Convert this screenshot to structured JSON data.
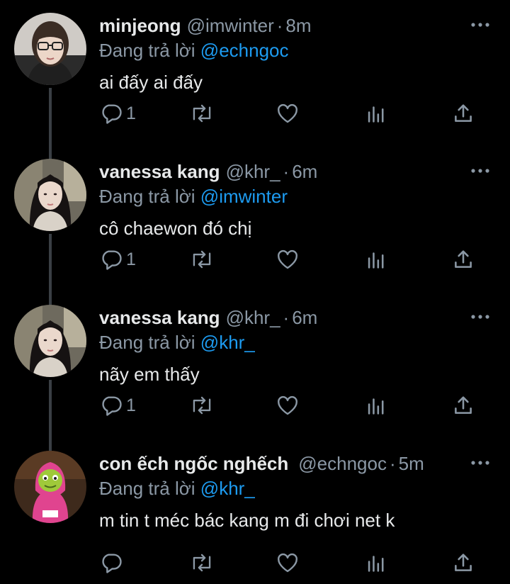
{
  "theme": {
    "background": "#000000",
    "text": "#e7e9ea",
    "muted": "#8b98a5",
    "accent": "#1d9bf0"
  },
  "tweets": [
    {
      "name": "minjeong",
      "handle": "@imwinter",
      "separator": "·",
      "time": "8m",
      "reply_prefix": "Đang trả lời",
      "reply_to": "@echngoc",
      "text": "ai đấy ai đấy",
      "reply_count": "1",
      "avatar": "avatar-photo-girl-glasses"
    },
    {
      "name": "vanessa kang",
      "handle": "@khr_",
      "separator": "·",
      "time": "6m",
      "reply_prefix": "Đang trả lời",
      "reply_to": "@imwinter",
      "text": "cô chaewon đó chị",
      "reply_count": "1",
      "avatar": "avatar-photo-girl-long-hair"
    },
    {
      "name": "vanessa kang",
      "handle": "@khr_",
      "separator": "·",
      "time": "6m",
      "reply_prefix": "Đang trả lời",
      "reply_to": "@khr_",
      "text": "nãy em thấy",
      "reply_count": "1",
      "avatar": "avatar-photo-girl-long-hair"
    },
    {
      "name": "con ếch ngốc nghếch",
      "handle": "@echngoc",
      "separator": "·",
      "time": "5m",
      "reply_prefix": "Đang trả lời",
      "reply_to": "@khr_",
      "text": "m tin t méc bác kang m đi chơi net k",
      "reply_count": "",
      "avatar": "avatar-frog-pink-hood"
    }
  ],
  "icons": {
    "reply": "reply-bubble-icon",
    "retweet": "retweet-icon",
    "like": "heart-icon",
    "views": "analytics-icon",
    "share": "share-icon",
    "more": "more-dots-icon"
  }
}
